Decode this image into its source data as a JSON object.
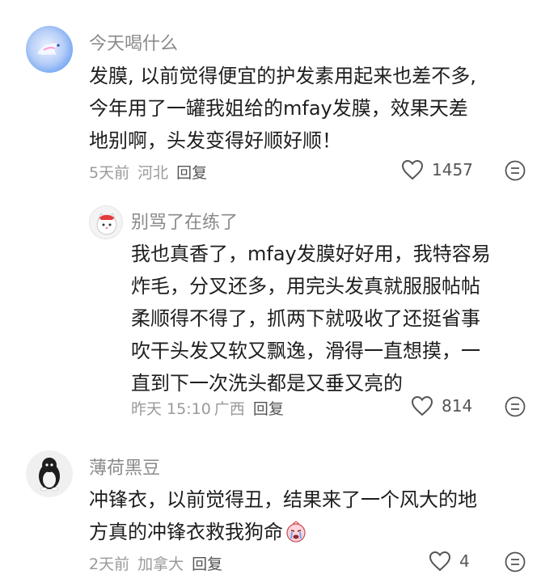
{
  "comments": [
    {
      "username": "今天喝什么",
      "lines": [
        "发膜, 以前觉得便宜的护发素用起来也差不多,",
        "今年用了一罐我姐给的mfay发膜，效果天差",
        "地别啊，头发变得好顺好顺！"
      ],
      "time": "5天前",
      "location": "河北",
      "reply_label": "回复",
      "likes": "1457",
      "avatar_icon": "bird-avatar-icon"
    },
    {
      "username": "别骂了在练了",
      "lines": [
        "我也真香了，mfay发膜好好用，我特容易",
        "炸毛，分叉还多，用完头发真就服服帖帖",
        "柔顺得不得了，抓两下就吸收了还挺省事",
        "吹干头发又软又飘逸，滑得一直想摸，一",
        "直到下一次洗头都是又垂又亮的"
      ],
      "time": "昨天 15:10",
      "location": "广西",
      "reply_label": "回复",
      "likes": "814",
      "avatar_icon": "cat-avatar-icon"
    },
    {
      "username": "薄荷黑豆",
      "lines": [
        "冲锋衣，以前觉得丑，结果来了一个风大的地",
        "方真的冲锋衣救我狗命"
      ],
      "time": "2天前",
      "location": "加拿大",
      "reply_label": "回复",
      "likes": "4",
      "avatar_icon": "penguin-avatar-icon"
    }
  ],
  "icons": {
    "like": "heart-outline-icon",
    "more": "more-dots-icon",
    "emoji": "crying-emoji-icon"
  }
}
